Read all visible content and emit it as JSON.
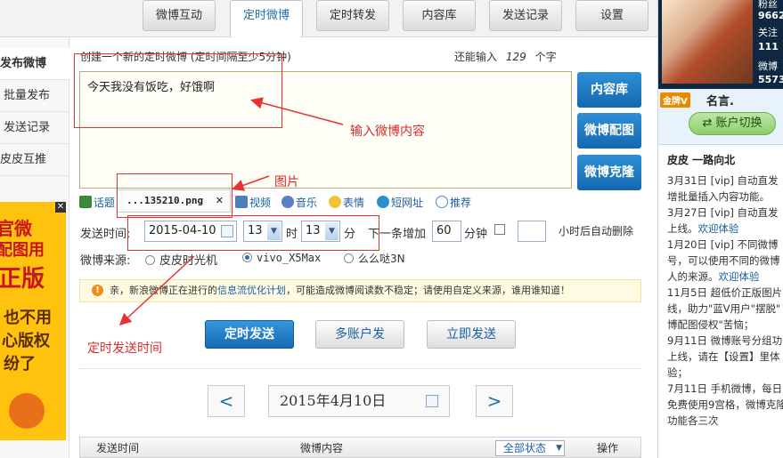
{
  "nav": {
    "tabs": [
      {
        "label": "微博互动"
      },
      {
        "label": "定时微博"
      },
      {
        "label": "定时转发"
      },
      {
        "label": "内容库"
      },
      {
        "label": "发送记录"
      },
      {
        "label": "设置"
      }
    ]
  },
  "sidebar": {
    "items": [
      {
        "label": "发布微博"
      },
      {
        "label": "批量发布"
      },
      {
        "label": "发送记录"
      },
      {
        "label": "皮皮互推"
      }
    ],
    "ad_lines": [
      "官微",
      "配图用",
      "正版",
      "也不用",
      "心版权",
      "纷了"
    ]
  },
  "composer": {
    "header": "创建一个新的定时微博 (定时间隔至少5分钟)",
    "remaining_prefix": "还能输入",
    "remaining_count": "129",
    "remaining_suffix": "个字",
    "text": "今天我没有饭吃，好饿啊"
  },
  "side_buttons": [
    "内容库",
    "微博配图",
    "微博克隆"
  ],
  "toolbar": {
    "topic": "话题",
    "attachment": "...135210.png",
    "video": "视频",
    "music": "音乐",
    "emoji": "表情",
    "short_url": "短网址",
    "recommend": "推荐"
  },
  "schedule": {
    "label": "发送时间:",
    "date": "2015-04-10",
    "hour": "13",
    "hour_unit": "时",
    "minute": "13",
    "minute_unit": "分",
    "increment_label": "下一条增加",
    "increment_value": "60",
    "increment_unit": "分钟",
    "after_hours_value": "",
    "auto_delete_label": "小时后自动删除"
  },
  "source": {
    "label": "微博来源:",
    "options": [
      {
        "label": "皮皮时光机",
        "selected": false
      },
      {
        "label": "vivo_X5Max",
        "selected": true
      },
      {
        "label": "么么哒3N",
        "selected": false
      }
    ]
  },
  "notice": {
    "text_before": "亲，新浪微博正在进行的",
    "link": "信息流优化计划",
    "text_after": "，可能造成微博阅读数不稳定；请使用自定义来源，谁用谁知道！"
  },
  "actions": {
    "timed_send": "定时发送",
    "multi_account": "多账户发",
    "send_now": "立即发送"
  },
  "date_nav": {
    "prev": "<",
    "current": "2015年4月10日",
    "next": ">"
  },
  "table": {
    "headers": [
      "发送时间",
      "微博内容",
      "全部状态",
      "操作"
    ]
  },
  "annotations": {
    "content": "输入微博内容",
    "image": "图片",
    "time": "定时发送时间"
  },
  "right_panel": {
    "stats": [
      "9662",
      "关注",
      "111",
      "微博",
      "5573"
    ],
    "header_top": "粉丝",
    "vip_badge": "金牌V",
    "name_row": "名言.",
    "switch_account": "账户切换",
    "news_title": "皮皮 一路向北",
    "news": [
      [
        "3月31日 [vip] 自动直发",
        ""
      ],
      [
        "增批量插入内容功能。",
        ""
      ],
      [
        "3月27日 [vip] 自动直发",
        ""
      ],
      [
        "上线。",
        "欢迎体验"
      ],
      [
        "1月20日 [vip] 不同微博",
        ""
      ],
      [
        "号，可以使用不同的微博",
        ""
      ],
      [
        "人的来源。",
        "欢迎体验"
      ],
      [
        "11月5日 超低价正版图片",
        ""
      ],
      [
        "线，助力\"蓝V用户\"摆脱\"",
        ""
      ],
      [
        "博配图侵权\"苦恼；",
        ""
      ],
      [
        "9月11日 微博账号分组功",
        ""
      ],
      [
        "上线，请在【设置】里体",
        ""
      ],
      [
        "验；",
        ""
      ],
      [
        "7月11日 手机微博，每日",
        ""
      ],
      [
        "免费使用9宫格，微博克隆",
        ""
      ],
      [
        "功能各三次",
        ""
      ]
    ]
  },
  "colors": {
    "accent_blue": "#1a6fb0",
    "annotation_red": "#e53232",
    "ad_yellow": "#ffc20e"
  }
}
